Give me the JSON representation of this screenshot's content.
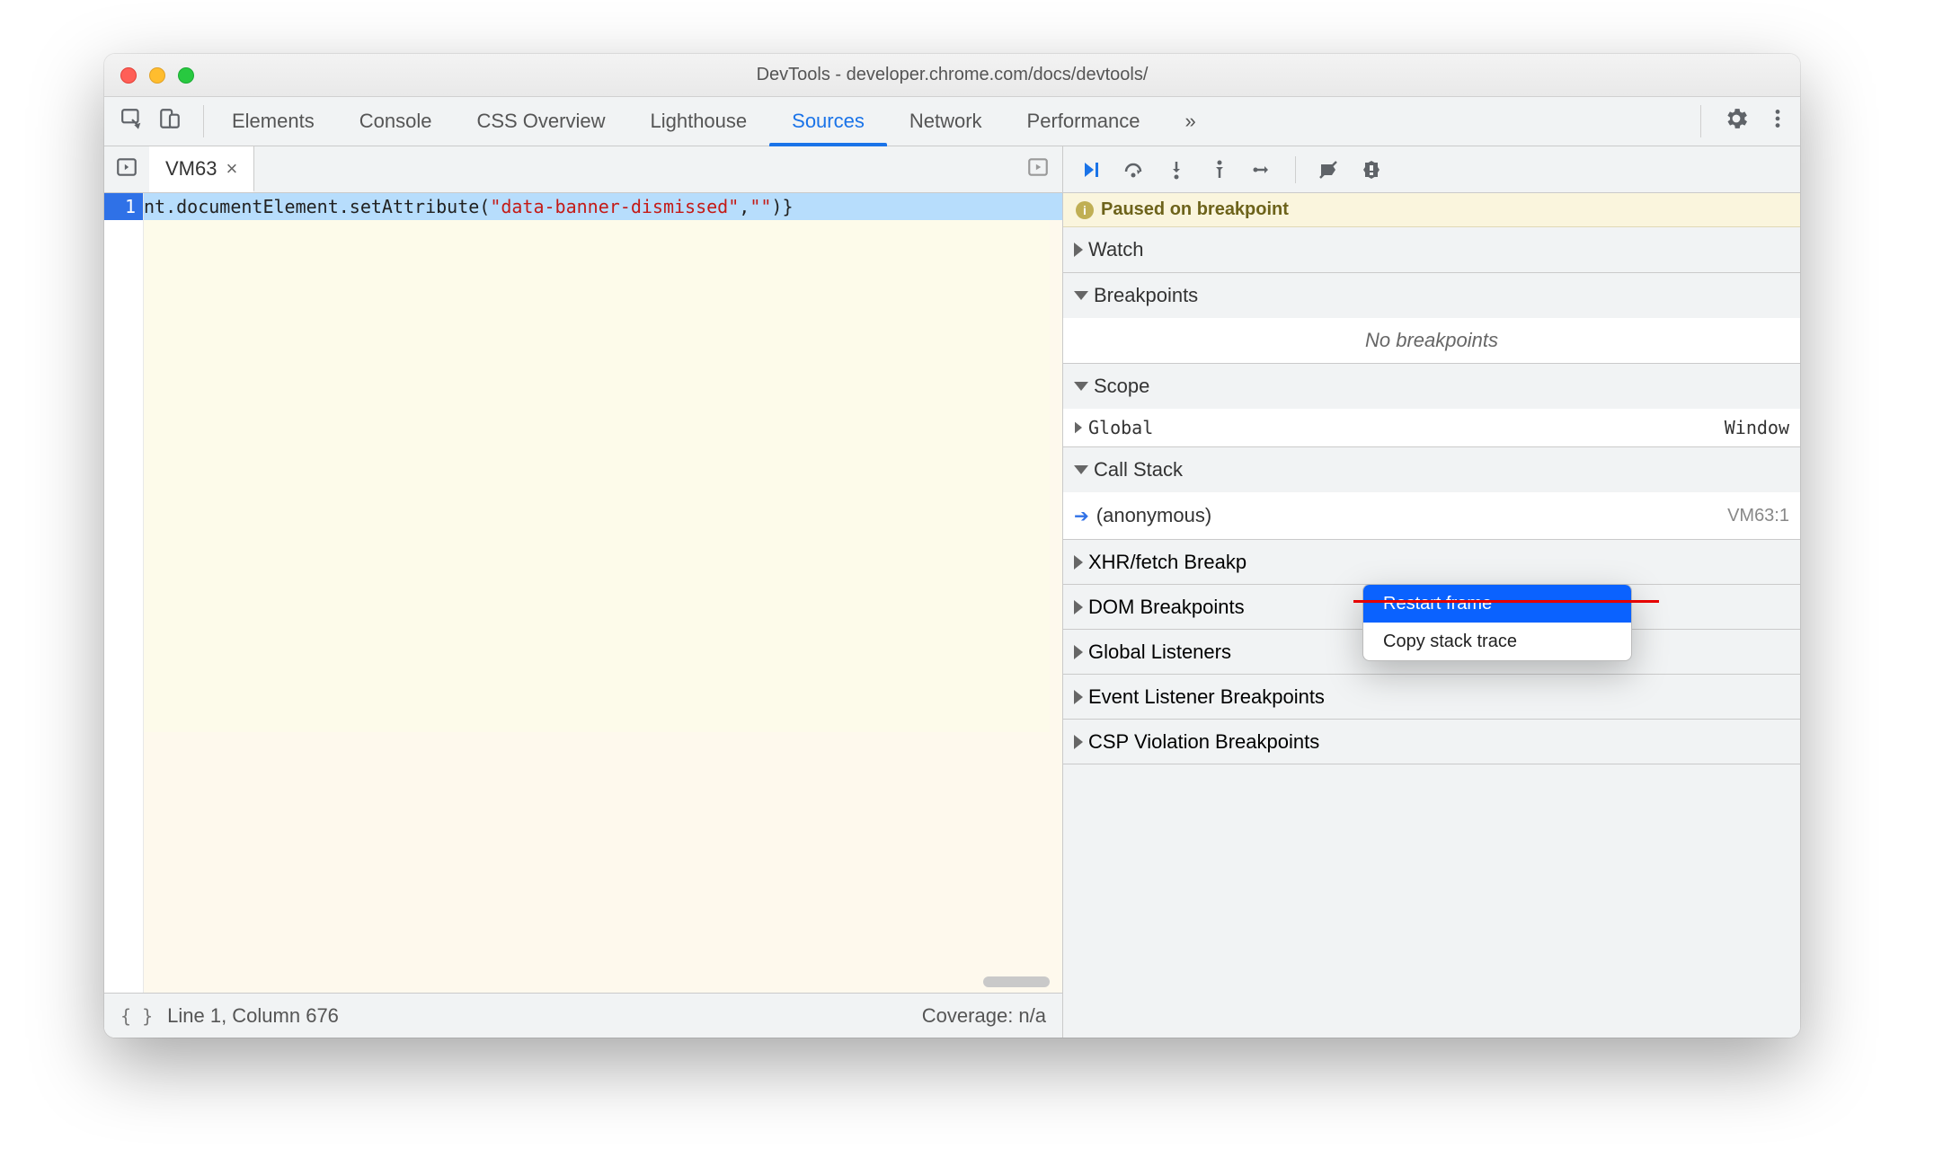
{
  "window": {
    "title": "DevTools - developer.chrome.com/docs/devtools/"
  },
  "tabs": {
    "items": [
      "Elements",
      "Console",
      "CSS Overview",
      "Lighthouse",
      "Sources",
      "Network",
      "Performance"
    ],
    "active": "Sources",
    "overflow": "»"
  },
  "openFile": {
    "name": "VM63",
    "close": "×"
  },
  "code": {
    "line1_part1": "nt.documentElement.setAttribute(",
    "line1_str": "\"data-banner-dismissed\"",
    "line1_comma": ",",
    "line1_str2": "\"\"",
    "line1_end": ")}",
    "lineNumber": "1"
  },
  "status": {
    "pretty": "{ }",
    "pos": "Line 1, Column 676",
    "coverage": "Coverage: n/a"
  },
  "paused": {
    "text": "Paused on breakpoint"
  },
  "sections": {
    "watch": "Watch",
    "breakpoints": "Breakpoints",
    "no_breakpoints": "No breakpoints",
    "scope": "Scope",
    "scope_global": "Global",
    "scope_global_val": "Window",
    "callstack": "Call Stack",
    "cs_frame": "(anonymous)",
    "cs_loc": "VM63:1",
    "xhr": "XHR/fetch Breakp",
    "dom": "DOM Breakpoints",
    "global_listeners": "Global Listeners",
    "event_listener": "Event Listener Breakpoints",
    "csp": "CSP Violation Breakpoints"
  },
  "context_menu": {
    "restart": "Restart frame",
    "copy": "Copy stack trace"
  }
}
